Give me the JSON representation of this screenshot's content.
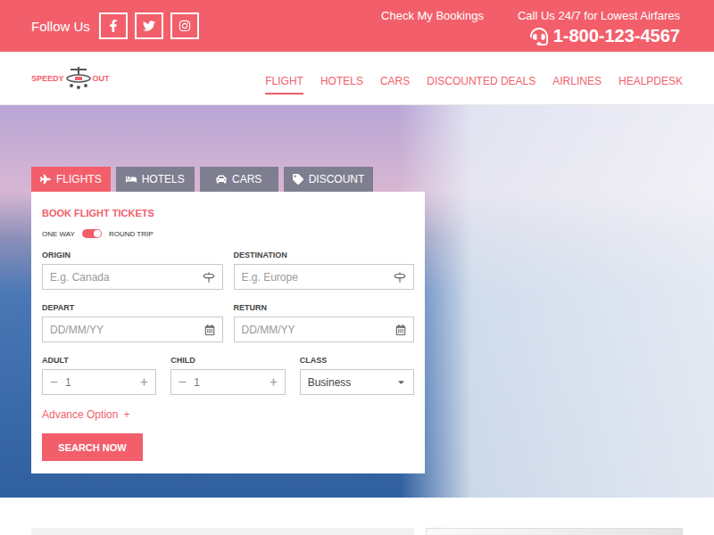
{
  "top_bar": {
    "follow_label": "Follow Us",
    "bookings": "Check My Bookings",
    "call_label": "Call Us 24/7 for Lowest Airfares",
    "phone": "1-800-123-4567"
  },
  "logo": {
    "left": "SPEEDY",
    "right": "OUT"
  },
  "nav": [
    {
      "label": "FLIGHT",
      "selected": true
    },
    {
      "label": "HOTELS",
      "selected": false
    },
    {
      "label": "CARS",
      "selected": false
    },
    {
      "label": "DISCOUNTED DEALS",
      "selected": false
    },
    {
      "label": "AIRLINES",
      "selected": false
    },
    {
      "label": "HEALPDESK",
      "selected": false
    }
  ],
  "search_tabs": [
    {
      "label": "FLIGHTS",
      "selected": true
    },
    {
      "label": "HOTELS",
      "selected": false
    },
    {
      "label": "CARS",
      "selected": false
    },
    {
      "label": "DISCOUNT",
      "selected": false
    }
  ],
  "form": {
    "title": "BOOK FLIGHT TICKETS",
    "trip_toggle": {
      "left": "ONE WAY",
      "right": "ROUND TRIP",
      "on": true
    },
    "fields": [
      {
        "label": "ORIGIN",
        "placeholder": "E.g. Canada",
        "kind": "place"
      },
      {
        "label": "DESTINATION",
        "placeholder": "E.g. Europe",
        "kind": "place"
      },
      {
        "label": "DEPART",
        "placeholder": "DD/MM/YY",
        "kind": "date"
      },
      {
        "label": "RETURN",
        "placeholder": "DD/MM/YY",
        "kind": "date"
      }
    ],
    "counters": [
      {
        "label": "ADULT",
        "value": "1"
      },
      {
        "label": "CHILD",
        "value": "1"
      }
    ],
    "class_select": {
      "label": "CLASS",
      "value": "Business"
    },
    "advance": {
      "label": "Advance Option",
      "mark": "+"
    },
    "button": "SEARCH NOW"
  }
}
